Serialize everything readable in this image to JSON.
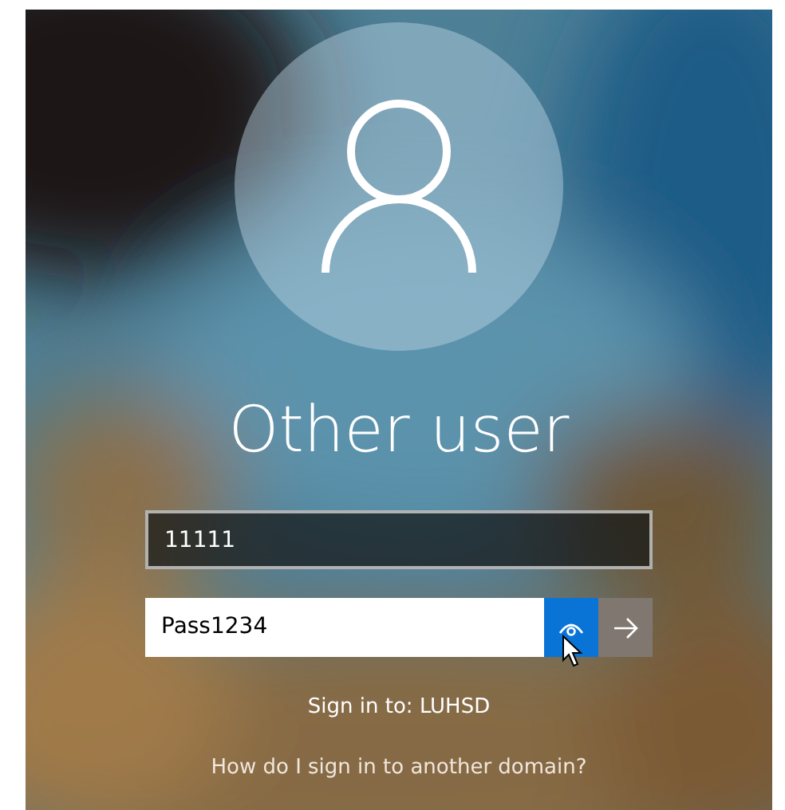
{
  "user": {
    "name": "Other user"
  },
  "username_field": {
    "value": "11111"
  },
  "password_field": {
    "value": "Pass1234",
    "reveal_pressed": true
  },
  "sign_in_to": "Sign in to: LUHSD",
  "domain_link": "How do I sign in to another domain?"
}
